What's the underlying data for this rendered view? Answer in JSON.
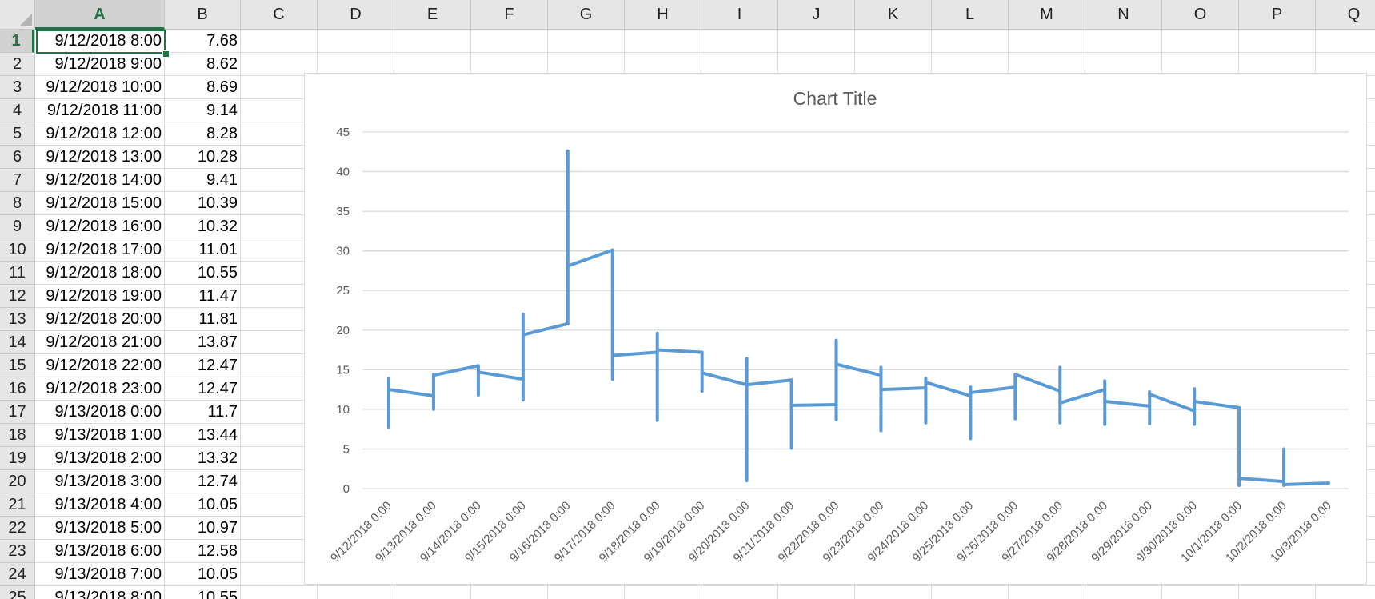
{
  "sheet": {
    "columns": [
      "A",
      "B",
      "C",
      "D",
      "E",
      "F",
      "G",
      "H",
      "I",
      "J",
      "K",
      "L",
      "M",
      "N",
      "O",
      "P",
      "Q"
    ],
    "selected_column": "A",
    "selected_row": 1,
    "rows": [
      {
        "num": "1",
        "a": "9/12/2018 8:00",
        "b": "7.68"
      },
      {
        "num": "2",
        "a": "9/12/2018 9:00",
        "b": "8.62"
      },
      {
        "num": "3",
        "a": "9/12/2018 10:00",
        "b": "8.69"
      },
      {
        "num": "4",
        "a": "9/12/2018 11:00",
        "b": "9.14"
      },
      {
        "num": "5",
        "a": "9/12/2018 12:00",
        "b": "8.28"
      },
      {
        "num": "6",
        "a": "9/12/2018 13:00",
        "b": "10.28"
      },
      {
        "num": "7",
        "a": "9/12/2018 14:00",
        "b": "9.41"
      },
      {
        "num": "8",
        "a": "9/12/2018 15:00",
        "b": "10.39"
      },
      {
        "num": "9",
        "a": "9/12/2018 16:00",
        "b": "10.32"
      },
      {
        "num": "10",
        "a": "9/12/2018 17:00",
        "b": "11.01"
      },
      {
        "num": "11",
        "a": "9/12/2018 18:00",
        "b": "10.55"
      },
      {
        "num": "12",
        "a": "9/12/2018 19:00",
        "b": "11.47"
      },
      {
        "num": "13",
        "a": "9/12/2018 20:00",
        "b": "11.81"
      },
      {
        "num": "14",
        "a": "9/12/2018 21:00",
        "b": "13.87"
      },
      {
        "num": "15",
        "a": "9/12/2018 22:00",
        "b": "12.47"
      },
      {
        "num": "16",
        "a": "9/12/2018 23:00",
        "b": "12.47"
      },
      {
        "num": "17",
        "a": "9/13/2018 0:00",
        "b": "11.7"
      },
      {
        "num": "18",
        "a": "9/13/2018 1:00",
        "b": "13.44"
      },
      {
        "num": "19",
        "a": "9/13/2018 2:00",
        "b": "13.32"
      },
      {
        "num": "20",
        "a": "9/13/2018 3:00",
        "b": "12.74"
      },
      {
        "num": "21",
        "a": "9/13/2018 4:00",
        "b": "10.05"
      },
      {
        "num": "22",
        "a": "9/13/2018 5:00",
        "b": "10.97"
      },
      {
        "num": "23",
        "a": "9/13/2018 6:00",
        "b": "12.58"
      },
      {
        "num": "24",
        "a": "9/13/2018 7:00",
        "b": "10.05"
      },
      {
        "num": "25",
        "a": "9/13/2018 8:00",
        "b": "10.55"
      }
    ]
  },
  "chart_data": {
    "type": "line",
    "title": "Chart Title",
    "xlabel": "",
    "ylabel": "",
    "ylim": [
      0,
      45
    ],
    "y_ticks": [
      "0",
      "5",
      "10",
      "15",
      "20",
      "25",
      "30",
      "35",
      "40",
      "45"
    ],
    "grid": true,
    "line_color": "#5b9bd5",
    "categories": [
      "9/12/2018 0:00",
      "9/13/2018 0:00",
      "9/14/2018 0:00",
      "9/15/2018 0:00",
      "9/16/2018 0:00",
      "9/17/2018 0:00",
      "9/18/2018 0:00",
      "9/19/2018 0:00",
      "9/20/2018 0:00",
      "9/21/2018 0:00",
      "9/22/2018 0:00",
      "9/23/2018 0:00",
      "9/24/2018 0:00",
      "9/25/2018 0:00",
      "9/26/2018 0:00",
      "9/27/2018 0:00",
      "9/28/2018 0:00",
      "9/29/2018 0:00",
      "9/30/2018 0:00",
      "10/1/2018 0:00",
      "10/2/2018 0:00",
      "10/3/2018 0:00"
    ],
    "segments": [
      {
        "range": [
          7.7,
          13.9
        ],
        "start": 12.5,
        "end": 11.7
      },
      {
        "range": [
          10.0,
          14.4
        ],
        "start": 14.3,
        "end": 15.5
      },
      {
        "range": [
          11.8,
          15.5
        ],
        "start": 14.7,
        "end": 13.8
      },
      {
        "range": [
          11.2,
          22.0
        ],
        "start": 19.4,
        "end": 20.8
      },
      {
        "range": [
          20.8,
          42.6
        ],
        "start": 28.1,
        "end": 30.1
      },
      {
        "range": [
          13.8,
          30.1
        ],
        "start": 16.8,
        "end": 17.2
      },
      {
        "range": [
          8.6,
          19.6
        ],
        "start": 17.5,
        "end": 17.2
      },
      {
        "range": [
          12.3,
          17.2
        ],
        "start": 14.6,
        "end": 13.1
      },
      {
        "range": [
          1.0,
          16.4
        ],
        "start": 13.1,
        "end": 13.7
      },
      {
        "range": [
          5.1,
          13.7
        ],
        "start": 10.5,
        "end": 10.6
      },
      {
        "range": [
          8.7,
          18.7
        ],
        "start": 15.7,
        "end": 14.3
      },
      {
        "range": [
          7.3,
          15.3
        ],
        "start": 12.5,
        "end": 12.7
      },
      {
        "range": [
          8.3,
          13.9
        ],
        "start": 13.4,
        "end": 11.7
      },
      {
        "range": [
          6.3,
          12.8
        ],
        "start": 12.1,
        "end": 12.8
      },
      {
        "range": [
          8.8,
          14.4
        ],
        "start": 14.4,
        "end": 12.3
      },
      {
        "range": [
          8.3,
          15.3
        ],
        "start": 10.8,
        "end": 12.5
      },
      {
        "range": [
          8.1,
          13.6
        ],
        "start": 11.0,
        "end": 10.4
      },
      {
        "range": [
          8.2,
          12.2
        ],
        "start": 11.9,
        "end": 9.8
      },
      {
        "range": [
          8.1,
          12.6
        ],
        "start": 11.0,
        "end": 10.2
      },
      {
        "range": [
          0.4,
          10.2
        ],
        "start": 1.3,
        "end": 0.9
      },
      {
        "range": [
          0.4,
          5.0
        ],
        "start": 0.5,
        "end": 0.7
      }
    ]
  }
}
